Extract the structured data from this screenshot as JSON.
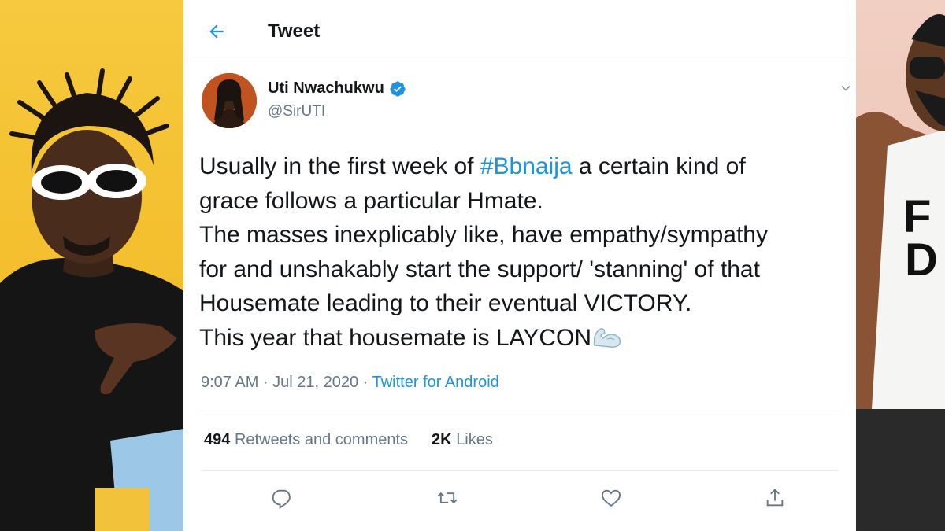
{
  "header": {
    "title": "Tweet",
    "back_icon": "arrow-left-icon"
  },
  "author": {
    "name": "Uti Nwachukwu",
    "handle": "@SirUTI",
    "verified": true
  },
  "tweet": {
    "lines": [
      {
        "before": "Usually in the first week of ",
        "hashtag": "#Bbnaija",
        "after": " a certain kind of"
      },
      {
        "text": "grace follows a particular Hmate."
      },
      {
        "text": "The masses inexplicably like, have empathy/sympathy"
      },
      {
        "text": "for and unshakably start the support/ 'stanning' of that"
      },
      {
        "text": "Housemate leading to their eventual VICTORY."
      },
      {
        "text": "This year that housemate is LAYCON",
        "emoji": "flexed-biceps"
      }
    ]
  },
  "meta": {
    "time": "9:07 AM",
    "sep": " · ",
    "date": "Jul 21, 2020",
    "source_sep": " · ",
    "source": "Twitter for Android"
  },
  "stats": {
    "retweets_count": "494",
    "retweets_label": "Retweets and comments",
    "likes_count": "2K",
    "likes_label": "Likes"
  },
  "actions": [
    "reply-icon",
    "retweet-icon",
    "like-icon",
    "share-icon"
  ],
  "colors": {
    "accent": "#1b95e0",
    "text": "#14171a",
    "muted": "#657786",
    "border": "#e6ecf0",
    "left_photo_bg": "#f3be2c",
    "right_photo_bg": "#eec4b5"
  }
}
